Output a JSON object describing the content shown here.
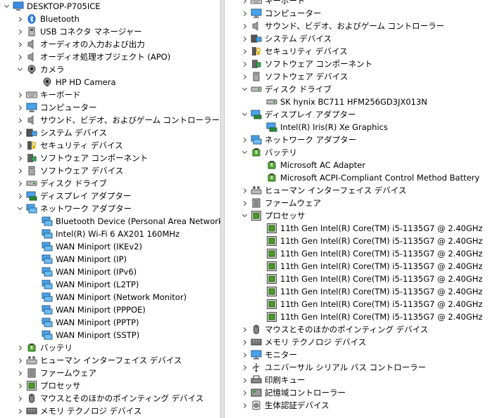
{
  "left": {
    "rows": [
      {
        "label": "DESKTOP-P705ICE",
        "level": 0,
        "chevron": "exp",
        "icon": "computer-icon"
      },
      {
        "label": "Bluetooth",
        "level": 1,
        "chevron": "col",
        "icon": "bluetooth-icon"
      },
      {
        "label": "USB コネクタ マネージャー",
        "level": 1,
        "chevron": "col",
        "icon": "usb-connector-icon"
      },
      {
        "label": "オーディオの入力および出力",
        "level": 1,
        "chevron": "col",
        "icon": "speaker-icon"
      },
      {
        "label": "オーディオ処理オブジェクト (APO)",
        "level": 1,
        "chevron": "col",
        "icon": "speaker-icon"
      },
      {
        "label": "カメラ",
        "level": 1,
        "chevron": "exp",
        "icon": "camera-icon"
      },
      {
        "label": "HP HD Camera",
        "level": 2,
        "chevron": "none",
        "icon": "camera-icon"
      },
      {
        "label": "キーボード",
        "level": 1,
        "chevron": "col",
        "icon": "keyboard-icon"
      },
      {
        "label": "コンピューター",
        "level": 1,
        "chevron": "col",
        "icon": "monitor-icon"
      },
      {
        "label": "サウンド、ビデオ、およびゲーム コントローラー",
        "level": 1,
        "chevron": "col",
        "icon": "speaker-icon"
      },
      {
        "label": "システム デバイス",
        "level": 1,
        "chevron": "col",
        "icon": "system-device-icon"
      },
      {
        "label": "セキュリティ デバイス",
        "level": 1,
        "chevron": "col",
        "icon": "security-device-icon"
      },
      {
        "label": "ソフトウェア コンポーネント",
        "level": 1,
        "chevron": "col",
        "icon": "software-component-icon"
      },
      {
        "label": "ソフトウェア デバイス",
        "level": 1,
        "chevron": "col",
        "icon": "software-device-icon"
      },
      {
        "label": "ディスク ドライブ",
        "level": 1,
        "chevron": "col",
        "icon": "disk-drive-icon"
      },
      {
        "label": "ディスプレイ アダプター",
        "level": 1,
        "chevron": "col",
        "icon": "display-adapter-icon"
      },
      {
        "label": "ネットワーク アダプター",
        "level": 1,
        "chevron": "exp",
        "icon": "network-adapter-icon"
      },
      {
        "label": "Bluetooth Device (Personal Area Network)",
        "level": 2,
        "chevron": "none",
        "icon": "network-adapter-icon"
      },
      {
        "label": "Intel(R) Wi-Fi 6 AX201 160MHz",
        "level": 2,
        "chevron": "none",
        "icon": "network-adapter-icon"
      },
      {
        "label": "WAN Miniport (IKEv2)",
        "level": 2,
        "chevron": "none",
        "icon": "network-adapter-icon"
      },
      {
        "label": "WAN Miniport (IP)",
        "level": 2,
        "chevron": "none",
        "icon": "network-adapter-icon"
      },
      {
        "label": "WAN Miniport (IPv6)",
        "level": 2,
        "chevron": "none",
        "icon": "network-adapter-icon"
      },
      {
        "label": "WAN Miniport (L2TP)",
        "level": 2,
        "chevron": "none",
        "icon": "network-adapter-icon"
      },
      {
        "label": "WAN Miniport (Network Monitor)",
        "level": 2,
        "chevron": "none",
        "icon": "network-adapter-icon"
      },
      {
        "label": "WAN Miniport (PPPOE)",
        "level": 2,
        "chevron": "none",
        "icon": "network-adapter-icon"
      },
      {
        "label": "WAN Miniport (PPTP)",
        "level": 2,
        "chevron": "none",
        "icon": "network-adapter-icon"
      },
      {
        "label": "WAN Miniport (SSTP)",
        "level": 2,
        "chevron": "none",
        "icon": "network-adapter-icon"
      },
      {
        "label": "バッテリ",
        "level": 1,
        "chevron": "col",
        "icon": "battery-icon"
      },
      {
        "label": "ヒューマン インターフェイス デバイス",
        "level": 1,
        "chevron": "col",
        "icon": "hid-icon"
      },
      {
        "label": "ファームウェア",
        "level": 1,
        "chevron": "col",
        "icon": "firmware-icon"
      },
      {
        "label": "プロセッサ",
        "level": 1,
        "chevron": "col",
        "icon": "processor-icon"
      },
      {
        "label": "マウスとそのほかのポインティング デバイス",
        "level": 1,
        "chevron": "col",
        "icon": "mouse-icon"
      },
      {
        "label": "メモリ テクノロジ デバイス",
        "level": 1,
        "chevron": "col",
        "icon": "memory-icon"
      }
    ]
  },
  "right": {
    "rows": [
      {
        "label": "キーボード",
        "level": 1,
        "chevron": "col",
        "icon": "keyboard-icon"
      },
      {
        "label": "コンピューター",
        "level": 1,
        "chevron": "col",
        "icon": "monitor-icon"
      },
      {
        "label": "サウンド、ビデオ、およびゲーム コントローラー",
        "level": 1,
        "chevron": "col",
        "icon": "speaker-icon"
      },
      {
        "label": "システム デバイス",
        "level": 1,
        "chevron": "col",
        "icon": "system-device-icon"
      },
      {
        "label": "セキュリティ デバイス",
        "level": 1,
        "chevron": "col",
        "icon": "security-device-icon"
      },
      {
        "label": "ソフトウェア コンポーネント",
        "level": 1,
        "chevron": "col",
        "icon": "software-component-icon"
      },
      {
        "label": "ソフトウェア デバイス",
        "level": 1,
        "chevron": "col",
        "icon": "software-device-icon"
      },
      {
        "label": "ディスク ドライブ",
        "level": 1,
        "chevron": "exp",
        "icon": "disk-drive-icon"
      },
      {
        "label": "SK hynix BC711 HFM256GD3JX013N",
        "level": 2,
        "chevron": "none",
        "icon": "disk-drive-icon"
      },
      {
        "label": "ディスプレイ アダプター",
        "level": 1,
        "chevron": "exp",
        "icon": "display-adapter-icon"
      },
      {
        "label": "Intel(R) Iris(R) Xe Graphics",
        "level": 2,
        "chevron": "none",
        "icon": "display-adapter-icon"
      },
      {
        "label": "ネットワーク アダプター",
        "level": 1,
        "chevron": "col",
        "icon": "network-adapter-icon"
      },
      {
        "label": "バッテリ",
        "level": 1,
        "chevron": "exp",
        "icon": "battery-icon"
      },
      {
        "label": "Microsoft AC Adapter",
        "level": 2,
        "chevron": "none",
        "icon": "battery-icon"
      },
      {
        "label": "Microsoft ACPI-Compliant Control Method Battery",
        "level": 2,
        "chevron": "none",
        "icon": "battery-icon"
      },
      {
        "label": "ヒューマン インターフェイス デバイス",
        "level": 1,
        "chevron": "col",
        "icon": "hid-icon"
      },
      {
        "label": "ファームウェア",
        "level": 1,
        "chevron": "col",
        "icon": "firmware-icon"
      },
      {
        "label": "プロセッサ",
        "level": 1,
        "chevron": "exp",
        "icon": "processor-icon"
      },
      {
        "label": "11th Gen Intel(R) Core(TM) i5-1135G7 @ 2.40GHz",
        "level": 2,
        "chevron": "none",
        "icon": "processor-icon"
      },
      {
        "label": "11th Gen Intel(R) Core(TM) i5-1135G7 @ 2.40GHz",
        "level": 2,
        "chevron": "none",
        "icon": "processor-icon"
      },
      {
        "label": "11th Gen Intel(R) Core(TM) i5-1135G7 @ 2.40GHz",
        "level": 2,
        "chevron": "none",
        "icon": "processor-icon"
      },
      {
        "label": "11th Gen Intel(R) Core(TM) i5-1135G7 @ 2.40GHz",
        "level": 2,
        "chevron": "none",
        "icon": "processor-icon"
      },
      {
        "label": "11th Gen Intel(R) Core(TM) i5-1135G7 @ 2.40GHz",
        "level": 2,
        "chevron": "none",
        "icon": "processor-icon"
      },
      {
        "label": "11th Gen Intel(R) Core(TM) i5-1135G7 @ 2.40GHz",
        "level": 2,
        "chevron": "none",
        "icon": "processor-icon"
      },
      {
        "label": "11th Gen Intel(R) Core(TM) i5-1135G7 @ 2.40GHz",
        "level": 2,
        "chevron": "none",
        "icon": "processor-icon"
      },
      {
        "label": "11th Gen Intel(R) Core(TM) i5-1135G7 @ 2.40GHz",
        "level": 2,
        "chevron": "none",
        "icon": "processor-icon"
      },
      {
        "label": "マウスとそのほかのポインティング デバイス",
        "level": 1,
        "chevron": "col",
        "icon": "mouse-icon"
      },
      {
        "label": "メモリ テクノロジ デバイス",
        "level": 1,
        "chevron": "col",
        "icon": "memory-icon"
      },
      {
        "label": "モニター",
        "level": 1,
        "chevron": "col",
        "icon": "monitor-icon"
      },
      {
        "label": "ユニバーサル シリアル バス コントローラー",
        "level": 1,
        "chevron": "col",
        "icon": "usb-controller-icon"
      },
      {
        "label": "印刷キュー",
        "level": 1,
        "chevron": "col",
        "icon": "print-queue-icon"
      },
      {
        "label": "記憶域コントローラー",
        "level": 1,
        "chevron": "col",
        "icon": "storage-controller-icon"
      },
      {
        "label": "生体認証デバイス",
        "level": 1,
        "chevron": "col",
        "icon": "biometric-icon"
      }
    ]
  }
}
